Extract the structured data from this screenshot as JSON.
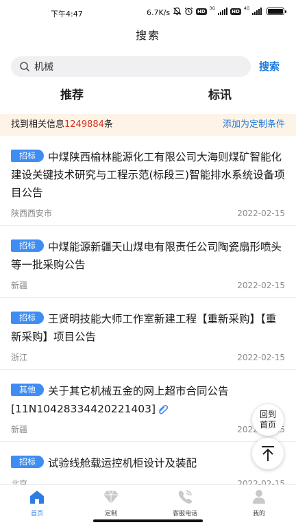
{
  "status_bar": {
    "time": "下午4:47",
    "speed": "6.7K/s",
    "net1": "3G",
    "net2": "4G",
    "hd": "HD"
  },
  "header": {
    "title": "搜索"
  },
  "search": {
    "value": "机械",
    "placeholder": "",
    "button_label": "搜索"
  },
  "tabs": [
    {
      "label": "推荐"
    },
    {
      "label": "标讯"
    }
  ],
  "info_bar": {
    "prefix": "找到相关信息",
    "count": "1249884",
    "suffix": "条",
    "add_label": "添加为定制条件"
  },
  "list": [
    {
      "badge": "招标",
      "title": "中煤陕西榆林能源化工有限公司大海则煤矿智能化建设关键技术研究与工程示范(标段三)智能排水系统设备项目公告",
      "region": "陕西西安市",
      "date": "2022-02-15"
    },
    {
      "badge": "招标",
      "title": "中煤能源新疆天山煤电有限责任公司陶瓷扇形喷头等一批采购公告",
      "region": "新疆",
      "date": "2022-02-15"
    },
    {
      "badge": "招标",
      "title": "王贤明技能大师工作室新建工程【重新采购】【重新采购】项目公告",
      "region": "浙江",
      "date": "2022-02-15"
    },
    {
      "badge": "其他",
      "title": "关于其它机械五金的网上超市合同公告[11N10428334420221403]",
      "region": "新疆",
      "date": "2022-02-15",
      "attachment": true
    },
    {
      "badge": "招标",
      "title": "试验线舱载运控机柜设计及装配",
      "region": "北京",
      "date": "2022-02-15"
    }
  ],
  "fab": {
    "home_line1": "回到",
    "home_line2": "首页"
  },
  "bottom_nav": [
    {
      "label": "首页",
      "icon": "home-icon",
      "active": true
    },
    {
      "label": "定制",
      "icon": "diamond-icon",
      "active": false
    },
    {
      "label": "客服电话",
      "icon": "phone-icon",
      "active": false
    },
    {
      "label": "我的",
      "icon": "user-icon",
      "active": false
    }
  ],
  "colors": {
    "accent": "#1f7ae0",
    "badge": "#3f8cf2",
    "count": "#d0321e",
    "info_bg": "#fdf3e6"
  }
}
